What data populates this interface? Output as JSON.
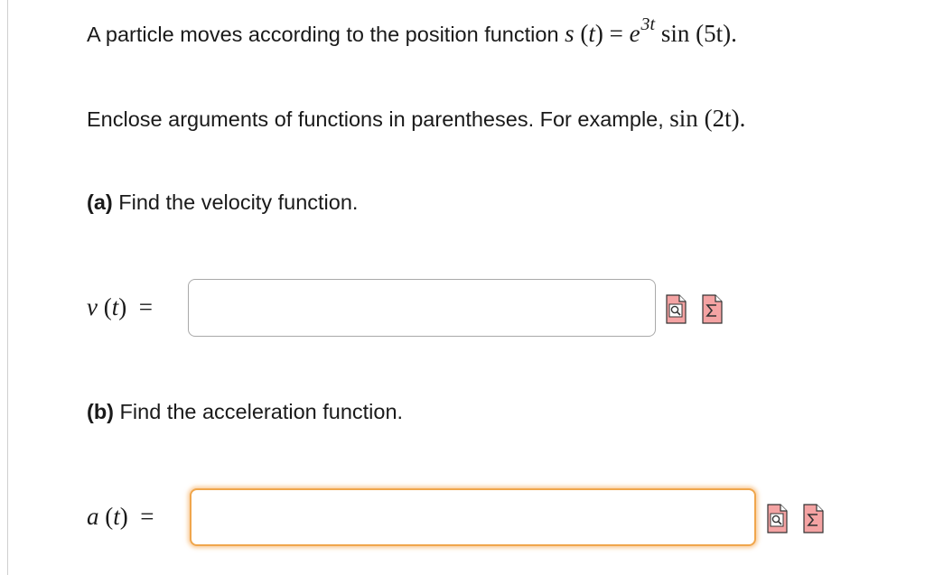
{
  "problem": {
    "intro_text": "A particle moves according to the position function",
    "s_func": {
      "lhs_name": "s",
      "var": "t",
      "base": "e",
      "exponent": "3t",
      "fn": "sin",
      "arg": "5t"
    },
    "instruction_text": "Enclose arguments of functions in parentheses. For example,",
    "example": {
      "fn": "sin",
      "arg": "2t"
    }
  },
  "part_a": {
    "letter": "(a)",
    "prompt": "Find the velocity function.",
    "fn_name": "v",
    "var": "t",
    "input_value": ""
  },
  "part_b": {
    "letter": "(b)",
    "prompt": "Find the acceleration function.",
    "fn_name": "a",
    "var": "t",
    "input_value": ""
  },
  "icons": [
    "preview-icon",
    "sigma-icon"
  ],
  "colors": {
    "focus": "#f0a64c",
    "icon_fill": "#f4a3a3"
  }
}
